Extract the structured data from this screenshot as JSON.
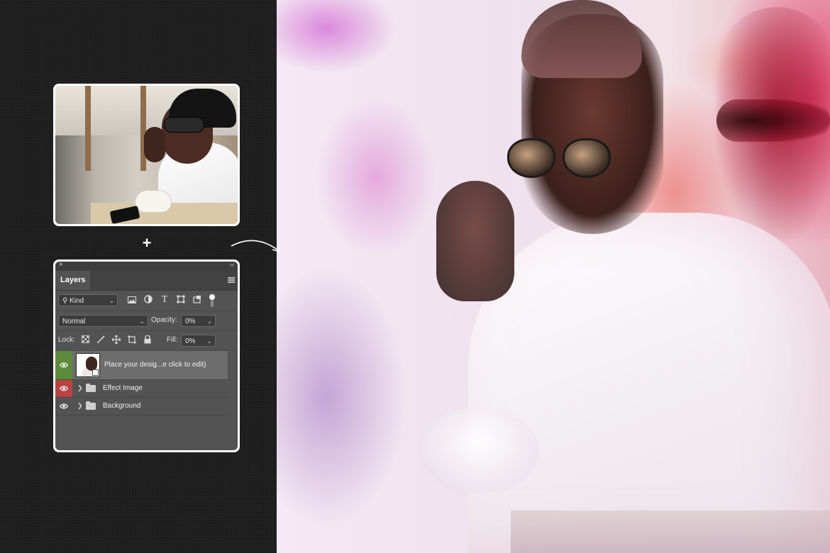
{
  "panel": {
    "close_glyph": "×",
    "collapse_glyph": "‹‹",
    "tab_label": "Layers",
    "filter": {
      "kind_label": "Kind",
      "icons": [
        "image-filter-icon",
        "adjustment-filter-icon",
        "type-filter-icon",
        "shape-filter-icon",
        "smart-object-filter-icon",
        "filter-toggle-icon"
      ]
    },
    "blend_mode": "Normal",
    "opacity_label": "Opacity:",
    "opacity_value": "0%",
    "lock_label": "Lock:",
    "lock_icons": [
      "lock-transparent-pixels-icon",
      "lock-image-pixels-icon",
      "lock-position-icon",
      "lock-artboard-icon",
      "lock-all-icon"
    ],
    "fill_label": "Fill:",
    "fill_value": "0%",
    "layers": [
      {
        "name": "Place your desig...e click to edit)",
        "type": "smart-object",
        "visible": true,
        "eye_color": "#5e8a3c",
        "selected": true
      },
      {
        "name": "Effect Image",
        "type": "group",
        "visible": true,
        "eye_color": "#b84343",
        "selected": false
      },
      {
        "name": "Background",
        "type": "group",
        "visible": true,
        "eye_color": "none",
        "selected": false
      }
    ]
  },
  "decor": {
    "plus_glyph": "+",
    "eye_glyph": "👁"
  },
  "colors": {
    "page_background": "#1f1f1f",
    "panel_background": "#535353",
    "selected_layer": "#6d6d6d",
    "eye_green": "#5e8a3c",
    "eye_red": "#b84343"
  }
}
